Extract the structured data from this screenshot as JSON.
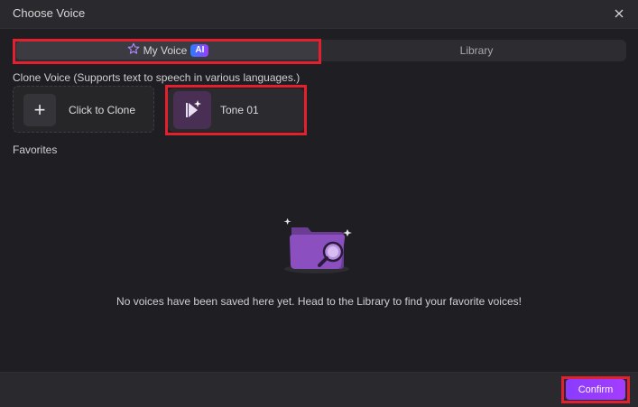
{
  "dialog": {
    "title": "Choose Voice"
  },
  "tabs": {
    "my_voice_label": "My Voice",
    "ai_badge": "AI",
    "library_label": "Library"
  },
  "clone_section": {
    "label": "Clone Voice (Supports text to speech in various languages.)",
    "clone_button_label": "Click to Clone",
    "plus_symbol": "+",
    "tone_label": "Tone 01"
  },
  "favorites": {
    "label": "Favorites",
    "empty_message": "No voices have been saved here yet. Head to the Library to find your favorite voices!"
  },
  "footer": {
    "confirm_label": "Confirm"
  },
  "colors": {
    "accent_purple": "#8a3cff",
    "highlight_red": "#e3212e",
    "ai_badge_blue": "#2b7cff"
  },
  "icons": {
    "close": "close-icon",
    "my_voice": "star-icon",
    "tone": "voice-play-sparkle-icon",
    "empty_state": "folder-search-icon"
  }
}
